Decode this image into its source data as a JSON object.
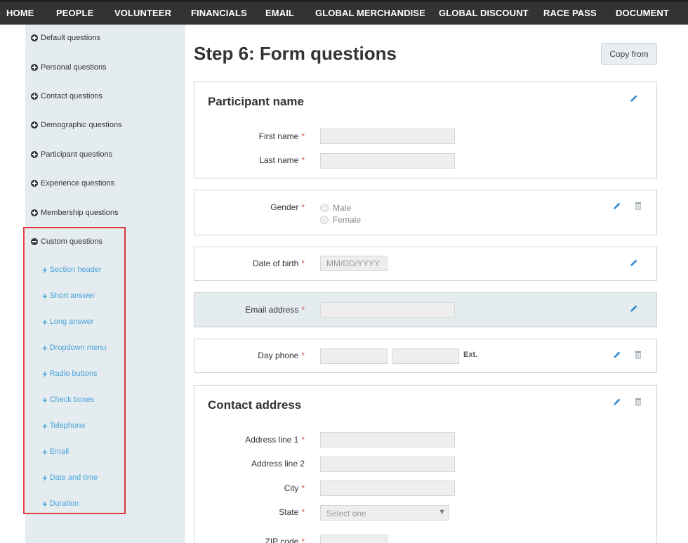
{
  "nav": {
    "items": [
      "HOME",
      "PEOPLE",
      "VOLUNTEER",
      "FINANCIALS",
      "EMAIL",
      "GLOBAL MERCHANDISE",
      "GLOBAL DISCOUNT",
      "RACE PASS",
      "DOCUMENT"
    ]
  },
  "sidebar": {
    "categories": [
      "Default questions",
      "Personal questions",
      "Contact questions",
      "Demographic questions",
      "Participant questions",
      "Experience questions",
      "Membership questions"
    ],
    "custom_label": "Custom questions",
    "custom_items": [
      "Section header",
      "Short answer",
      "Long answer",
      "Dropdown menu",
      "Radio buttons",
      "Check boxes",
      "Telephone",
      "Email",
      "Date and time",
      "Duration"
    ]
  },
  "main": {
    "title": "Step 6: Form questions",
    "copy_label": "Copy from",
    "required_mark": "*",
    "participant_name": {
      "title": "Participant name",
      "first_label": "First name",
      "last_label": "Last name"
    },
    "gender": {
      "label": "Gender",
      "options": [
        "Male",
        "Female"
      ]
    },
    "dob": {
      "label": "Date of birth",
      "placeholder": "MM/DD/YYYY"
    },
    "email": {
      "label": "Email address"
    },
    "phone": {
      "label": "Day phone",
      "ext_label": "Ext."
    },
    "contact_address": {
      "title": "Contact address",
      "line1_label": "Address line 1",
      "line2_label": "Address line 2",
      "city_label": "City",
      "state_label": "State",
      "state_value": "Select one",
      "zip_label": "ZIP code"
    }
  },
  "colors": {
    "nav_bg": "#333333",
    "sidebar_bg": "#e4ecf0",
    "link_blue": "#4aa3d8",
    "highlight_red": "#e0393e",
    "required_red": "#d9534f"
  }
}
